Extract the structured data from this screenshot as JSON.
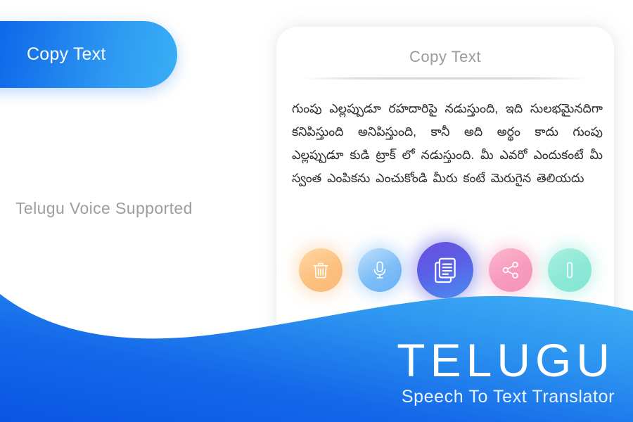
{
  "badge": {
    "label": "Copy Text"
  },
  "left_panel": {
    "caption": "Telugu Voice Supported"
  },
  "card": {
    "title": "Copy Text",
    "body_text": "గుంపు ఎల్లప్పుడూ రహదారిపై నడుస్తుంది, ఇది సులభమైనదిగా కనిపిస్తుంది అనిపిస్తుంది, కానీ అది అర్థం కాదు గుంపు ఎల్లప్పుడూ కుడి ట్రాక్ లో నడుస్తుంది. మీ ఎవరో ఎందుకంటే మీ స్వంత ఎంపికను ఎంచుకోండి మీరు కంటే మెరుగైన తెలియదు",
    "actions": [
      {
        "name": "delete",
        "label": "Delete",
        "icon": "trash-icon",
        "color": "#fcc07f"
      },
      {
        "name": "microphone",
        "label": "Microphone",
        "icon": "microphone-icon",
        "color": "#7ebdf7"
      },
      {
        "name": "copy",
        "label": "Copy",
        "icon": "copy-icon",
        "color": "#5a5fe6"
      },
      {
        "name": "share",
        "label": "Share",
        "icon": "share-icon",
        "color": "#f79bbd"
      },
      {
        "name": "paste",
        "label": "Paste",
        "icon": "paste-icon",
        "color": "#8ce8d6"
      }
    ]
  },
  "footer": {
    "title": "TELUGU",
    "subtitle": "Speech To Text Translator"
  },
  "colors": {
    "brand_blue_dark": "#0b5fe5",
    "brand_blue_light": "#39aef5",
    "background": "#ffffff",
    "muted_text": "#9d9d9d",
    "body_text": "#2d2d2d"
  }
}
